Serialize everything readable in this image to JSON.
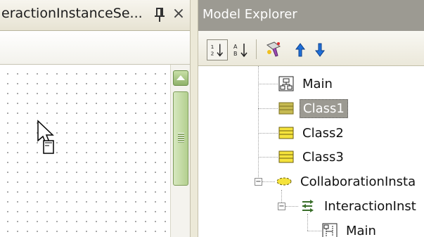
{
  "left_panel": {
    "title": "eractionInstanceSe...",
    "pin_icon": "pin-icon",
    "close_glyph": "×"
  },
  "right_panel": {
    "title": "Model Explorer",
    "toolbar": {
      "buttons": [
        "sort-order-icon",
        "sort-alpha-icon",
        "filter-icon",
        "move-up-icon",
        "move-down-icon"
      ]
    },
    "tree": {
      "items": [
        {
          "label": "Main",
          "icon": "diagram-icon",
          "selected": false
        },
        {
          "label": "Class1",
          "icon": "class-icon",
          "selected": true
        },
        {
          "label": "Class2",
          "icon": "class-icon",
          "selected": false
        },
        {
          "label": "Class3",
          "icon": "class-icon",
          "selected": false
        },
        {
          "label": "CollaborationInsta",
          "icon": "collaboration-icon",
          "selected": false
        },
        {
          "label": "InteractionInst",
          "icon": "interaction-icon",
          "selected": false
        },
        {
          "label": "Main",
          "icon": "diagram-icon",
          "selected": false
        }
      ]
    }
  },
  "colors": {
    "title_bar_inactive": "#9c9a92",
    "class_icon": "#f5e33c",
    "scrollbar_green": "#a6c47e",
    "arrow_blue": "#1f6fd8"
  }
}
